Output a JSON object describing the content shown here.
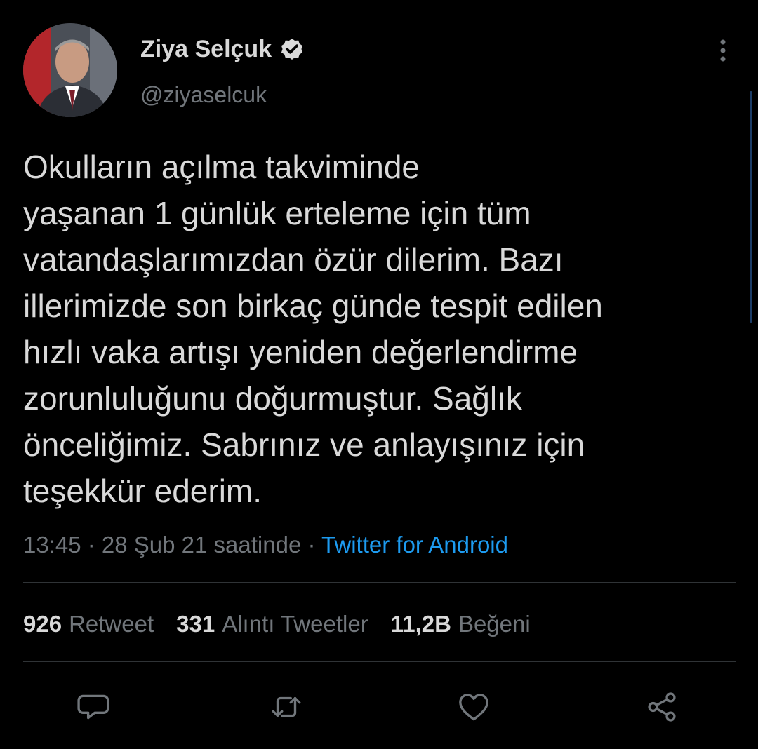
{
  "author": {
    "display_name": "Ziya Selçuk",
    "handle": "@ziyaselcuk",
    "verified": true
  },
  "tweet": {
    "lines": [
      "Okulların açılma takviminde",
      "yaşanan 1 günlük erteleme için tüm",
      "vatandaşlarımızdan özür dilerim. Bazı",
      "illerimizde son birkaç günde tespit edilen",
      "hızlı vaka artışı yeniden değerlendirme",
      "zorunluluğunu doğurmuştur. Sağlık",
      "önceliğimiz. Sabrınız ve anlayışınız için",
      "teşekkür ederim."
    ],
    "timestamp": "13:45 · 28 Şub 21 saatinde · ",
    "source": "Twitter for Android"
  },
  "stats": {
    "retweets_count": "926",
    "retweets_label": "Retweet",
    "quotes_count": "331",
    "quotes_label": "Alıntı Tweetler",
    "likes_count": "11,2B",
    "likes_label": "Beğeni"
  },
  "actions": [
    {
      "icon": "reply-icon"
    },
    {
      "icon": "retweet-icon"
    },
    {
      "icon": "like-icon"
    },
    {
      "icon": "share-icon"
    }
  ],
  "colors": {
    "background": "#000000",
    "text": "#d9d9d9",
    "secondary": "#71767b",
    "link": "#1d9bf0",
    "divider": "#2f3336"
  }
}
